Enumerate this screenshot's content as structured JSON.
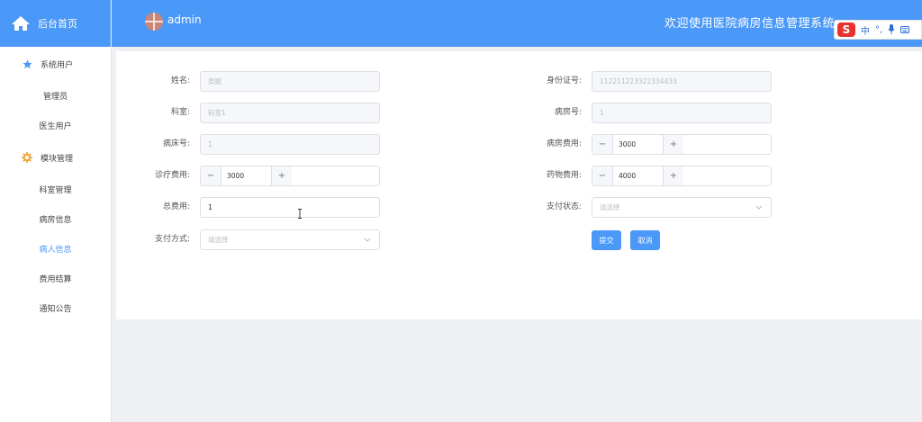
{
  "sidebar": {
    "home_label": "后台首页",
    "groups": [
      {
        "label": "系统用户",
        "icon": "star-icon",
        "items": [
          "管理员",
          "医生用户"
        ]
      },
      {
        "label": "模块管理",
        "icon": "gear-icon",
        "items": [
          "科室管理",
          "病房信息",
          "病人信息",
          "费用结算",
          "通知公告"
        ]
      }
    ],
    "active_item": "病人信息"
  },
  "header": {
    "user": "admin",
    "welcome": "欢迎使用医院病房信息管理系统"
  },
  "ime": {
    "logo": "S",
    "mode": "中",
    "punct": "°,"
  },
  "form": {
    "name": {
      "label": "姓名:",
      "value": "周振"
    },
    "id_card": {
      "label": "身份证号:",
      "value": "112211223322334433"
    },
    "dept": {
      "label": "科室:",
      "value": "科室1"
    },
    "room_no": {
      "label": "病房号:",
      "value": "1"
    },
    "bed_no": {
      "label": "病床号:",
      "value": "1"
    },
    "room_fee": {
      "label": "病房费用:",
      "value": "3000",
      "minus": "−",
      "plus": "+"
    },
    "treatment_fee": {
      "label": "诊疗费用:",
      "value": "3000",
      "minus": "−",
      "plus": "+"
    },
    "drug_fee": {
      "label": "药物费用:",
      "value": "4000",
      "minus": "−",
      "plus": "+"
    },
    "total_fee": {
      "label": "总费用:",
      "value": "1"
    },
    "pay_status": {
      "label": "支付状态:",
      "placeholder": "请选择"
    },
    "pay_method": {
      "label": "支付方式:",
      "placeholder": "请选择"
    },
    "submit_label": "提交",
    "cancel_label": "取消"
  },
  "colors": {
    "primary": "#4a98f7",
    "background": "#eef0f4"
  }
}
